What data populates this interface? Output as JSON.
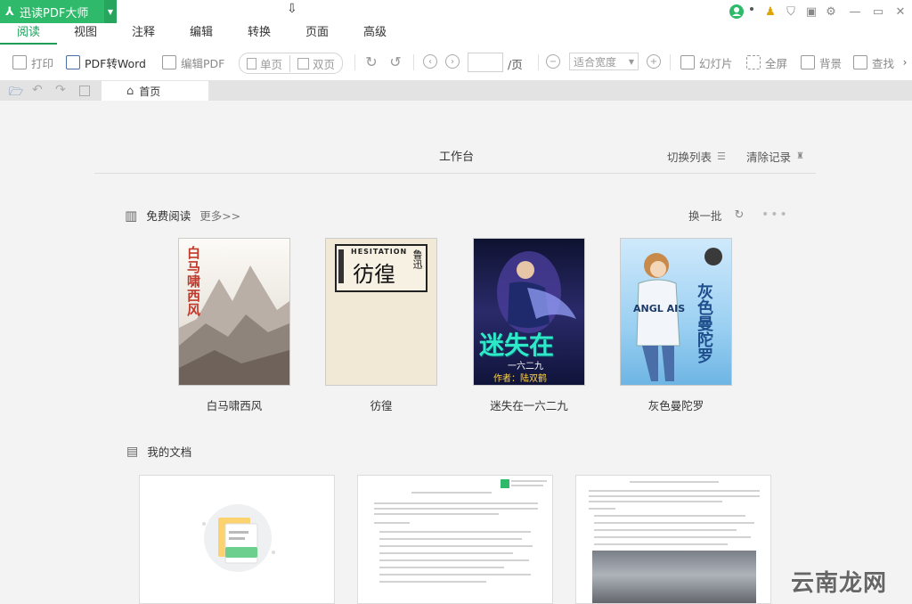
{
  "app": {
    "name": "迅读PDF大师"
  },
  "menu_tabs": [
    "阅读",
    "视图",
    "注释",
    "编辑",
    "转换",
    "页面",
    "高级"
  ],
  "toolbar": {
    "print": "打印",
    "pdf_to_word": "PDF转Word",
    "edit_pdf": "编辑PDF",
    "single_page": "单页",
    "double_page": "双页",
    "page_input_value": "",
    "page_total": "/页",
    "zoom_option": "适合宽度",
    "slideshow": "幻灯片",
    "fullscreen": "全屏",
    "background": "背景",
    "find": "查找"
  },
  "tab": {
    "home": "首页"
  },
  "workbench": {
    "title": "工作台",
    "switch_list": "切换列表",
    "clear_history": "清除记录"
  },
  "free_reading": {
    "title": "免费阅读",
    "more": "更多>>",
    "change_batch": "换一批",
    "books": [
      {
        "title": "白马啸西风",
        "cover_text": "白马啸西风"
      },
      {
        "title": "彷徨",
        "cover_text": "彷徨",
        "cover_en": "HESITATION",
        "cover_author": "鲁迅"
      },
      {
        "title": "迷失在一六二九",
        "cover_text": "迷失在",
        "cover_sub": "一六二九",
        "cover_author": "作者：陆双鹤"
      },
      {
        "title": "灰色曼陀罗",
        "cover_text": "灰色曼陀罗",
        "cover_en": "ANGL AIS"
      }
    ]
  },
  "my_documents": {
    "title": "我的文档"
  },
  "watermark": "云南龙网",
  "colors": {
    "accent": "#2fba6b",
    "active_tab": "#1f9e5a"
  }
}
